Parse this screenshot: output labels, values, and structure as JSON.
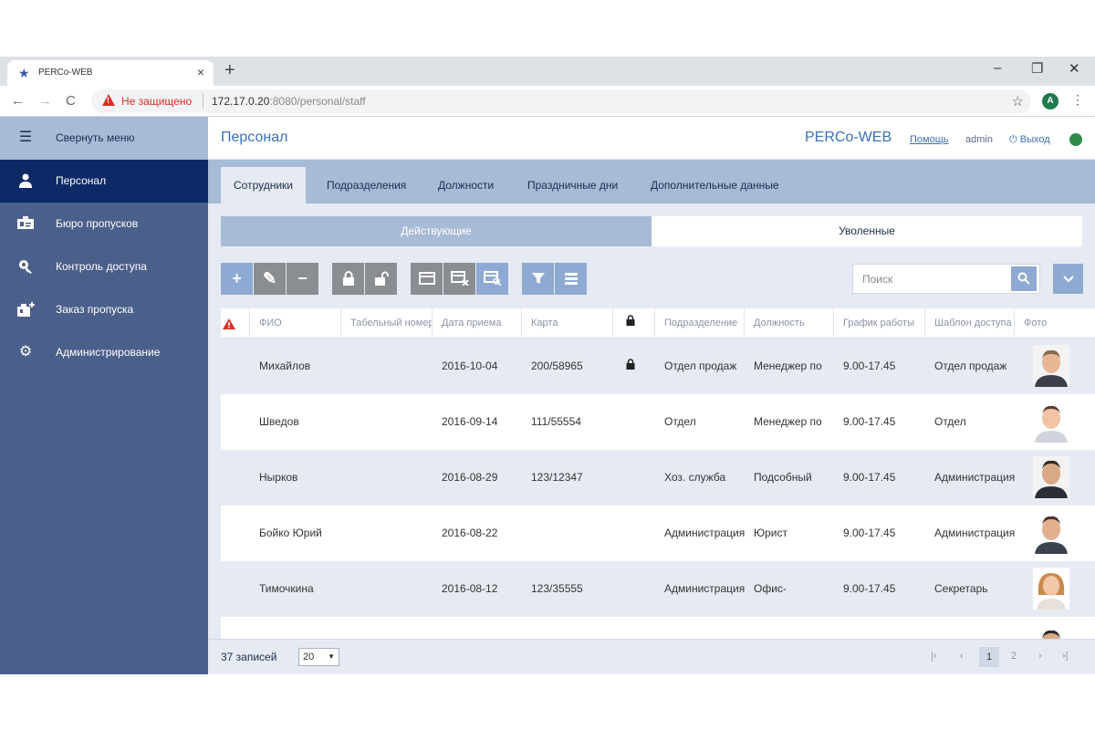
{
  "browser": {
    "tab_title": "PERCo-WEB",
    "tab_close": "×",
    "new_tab": "+",
    "minimize": "–",
    "restore": "❐",
    "close": "✕",
    "back": "←",
    "forward": "→",
    "reload": "C",
    "insecure_label": "Не защищено",
    "url_host": "172.17.0.20",
    "url_rest": ":8080/personal/staff",
    "bookmark": "☆",
    "profile_initial": "A",
    "menu": "⋮"
  },
  "sidebar": {
    "collapse_label": "Свернуть меню",
    "items": [
      {
        "label": "Персонал",
        "icon": "person-icon",
        "active": true
      },
      {
        "label": "Бюро пропусков",
        "icon": "id-card-icon",
        "active": false
      },
      {
        "label": "Контроль доступа",
        "icon": "key-icon",
        "active": false
      },
      {
        "label": "Заказ пропуска",
        "icon": "pass-order-icon",
        "active": false
      },
      {
        "label": "Администрирование",
        "icon": "gear-icon",
        "active": false
      }
    ]
  },
  "header": {
    "page_title": "Персонал",
    "brand": "PERCo-WEB",
    "help": "Помощь",
    "user": "admin",
    "logout": "Выход",
    "status_color": "#2f8a4a"
  },
  "tabs": [
    {
      "label": "Сотрудники",
      "active": true
    },
    {
      "label": "Подразделения",
      "active": false
    },
    {
      "label": "Должности",
      "active": false
    },
    {
      "label": "Праздничные дни",
      "active": false
    },
    {
      "label": "Дополнительные данные",
      "active": false
    }
  ],
  "segment": {
    "active": "Действующие",
    "inactive": "Уволенные"
  },
  "search": {
    "placeholder": "Поиск"
  },
  "table": {
    "columns": [
      "",
      "ФИО",
      "Табельный номер",
      "Дата приема",
      "Карта",
      "",
      "Подразделение",
      "Должность",
      "График работы",
      "Шаблон доступа",
      "Фото"
    ],
    "rows": [
      {
        "name": "Михайлов",
        "tab": "",
        "date": "2016-10-04",
        "card": "200/58965",
        "locked": true,
        "dept": "Отдел продаж",
        "position": "Менеджер по",
        "schedule": "9.00-17.45",
        "template": "Отдел продаж",
        "photo": "male-1"
      },
      {
        "name": "Шведов",
        "tab": "",
        "date": "2016-09-14",
        "card": "111/55554",
        "locked": false,
        "dept": "Отдел",
        "position": "Менеджер по",
        "schedule": "9.00-17.45",
        "template": "Отдел",
        "photo": "male-2"
      },
      {
        "name": "Нырков",
        "tab": "",
        "date": "2016-08-29",
        "card": "123/12347",
        "locked": false,
        "dept": "Хоз. служба",
        "position": "Подсобный",
        "schedule": "9.00-17.45",
        "template": "Администрация",
        "photo": "male-3"
      },
      {
        "name": "Бойко Юрий",
        "tab": "",
        "date": "2016-08-22",
        "card": "",
        "locked": false,
        "dept": "Администрация",
        "position": "Юрист",
        "schedule": "9.00-17.45",
        "template": "Администрация",
        "photo": "male-4"
      },
      {
        "name": "Тимочкина",
        "tab": "",
        "date": "2016-08-12",
        "card": "123/35555",
        "locked": false,
        "dept": "Администрация",
        "position": "Офис-",
        "schedule": "9.00-17.45",
        "template": "Секретарь",
        "photo": "female-1"
      }
    ]
  },
  "footer": {
    "count": "37 записей",
    "page_size": "20",
    "pages": [
      "1",
      "2"
    ],
    "current_page": "1",
    "first": "|‹",
    "prev": "‹",
    "next": "›",
    "last": "›|"
  },
  "colors": {
    "sidebar_bg": "#4a5f8a",
    "sidebar_active": "#0d2a66",
    "accent": "#3e6fb5",
    "header_band": "#a7bad6",
    "content_bg": "#e6ebf3"
  }
}
